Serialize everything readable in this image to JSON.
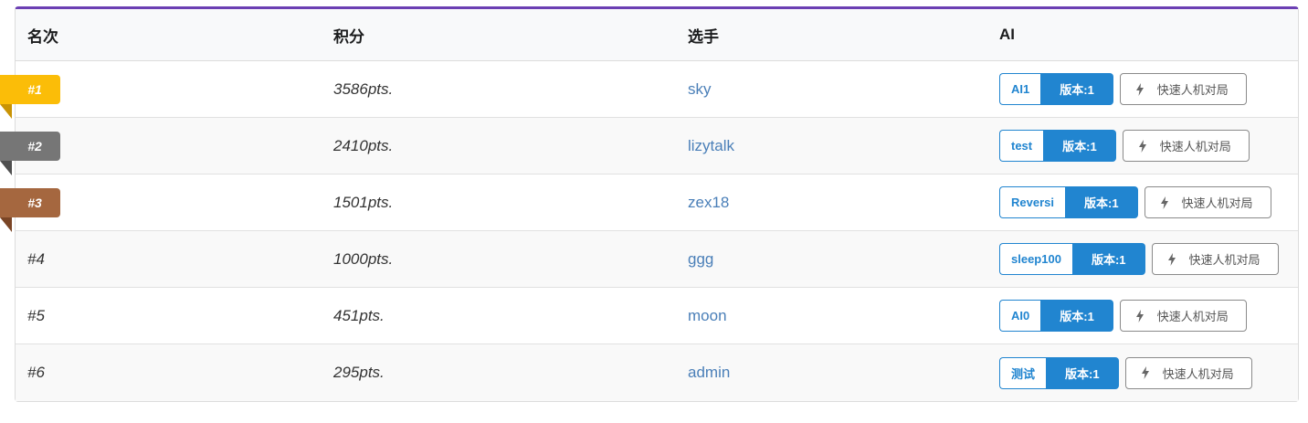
{
  "table": {
    "headers": {
      "rank": "名次",
      "score": "积分",
      "player": "选手",
      "ai": "AI"
    },
    "quick_play_label": "快速人机对局",
    "rows": [
      {
        "rank": "#1",
        "score": "3586pts.",
        "player": "sky",
        "ai_name": "AI1",
        "ai_version": "版本:1",
        "ribbon": "gold"
      },
      {
        "rank": "#2",
        "score": "2410pts.",
        "player": "lizytalk",
        "ai_name": "test",
        "ai_version": "版本:1",
        "ribbon": "gray"
      },
      {
        "rank": "#3",
        "score": "1501pts.",
        "player": "zex18",
        "ai_name": "Reversi",
        "ai_version": "版本:1",
        "ribbon": "bronze"
      },
      {
        "rank": "#4",
        "score": "1000pts.",
        "player": "ggg",
        "ai_name": "sleep100",
        "ai_version": "版本:1"
      },
      {
        "rank": "#5",
        "score": "451pts.",
        "player": "moon",
        "ai_name": "AI0",
        "ai_version": "版本:1"
      },
      {
        "rank": "#6",
        "score": "295pts.",
        "player": "admin",
        "ai_name": "测试",
        "ai_version": "版本:1"
      }
    ]
  },
  "colors": {
    "accent_top_border": "#6b3fb3",
    "primary_blue": "#2185d0",
    "link_blue": "#4a7fb8",
    "ribbon_gold": "#fbbd08",
    "ribbon_gray": "#767676",
    "ribbon_bronze": "#a5673f"
  },
  "icons": {
    "quick_play": "lightning-bolt-icon"
  }
}
